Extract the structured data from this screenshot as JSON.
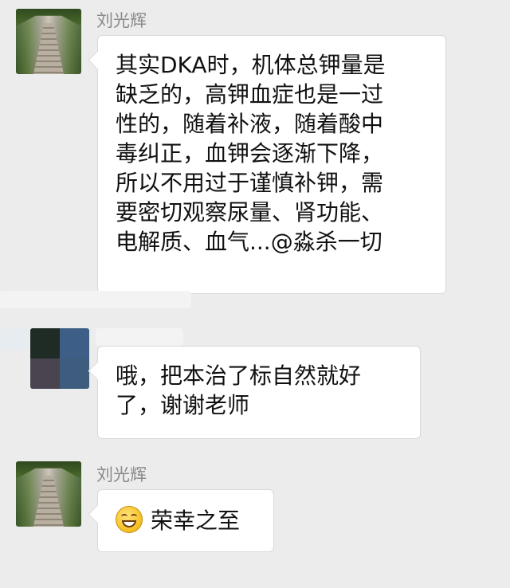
{
  "messages": [
    {
      "sender": "刘光辉",
      "lines": [
        "其实DKA时，机体总钾量是",
        "缺乏的，高钾血症也是一过",
        "性的，随着补液，随着酸中",
        "毒纠正，血钾会逐渐下降，",
        "所以不用过于谨慎补钾，需",
        "要密切观察尿量、肾功能、",
        "电解质、血气...@淼杀一切"
      ]
    },
    {
      "sender": "",
      "lines": [
        "哦，把本治了标自然就好",
        "了，谢谢老师"
      ]
    },
    {
      "sender": "刘光辉",
      "text": "荣幸之至",
      "emoji": "grinning-face-emoji"
    }
  ]
}
